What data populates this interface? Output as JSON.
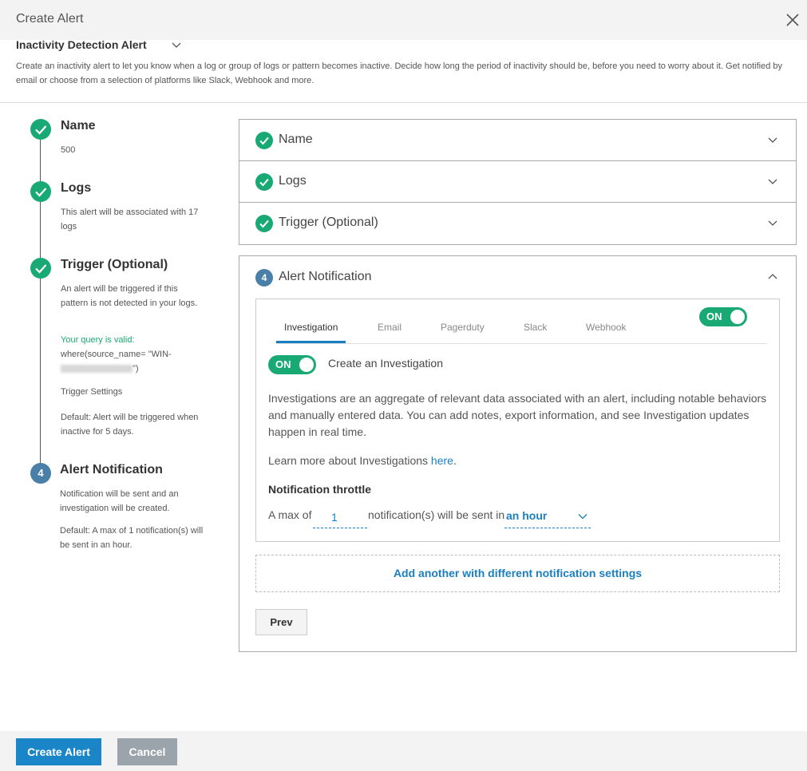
{
  "header": {
    "title": "Create Alert",
    "alert_type": "Inactivity Detection Alert",
    "description": "Create an inactivity alert to let you know when a log or group of logs or pattern becomes inactive. Decide how long the period of inactivity should be, before you need to worry about it. Get notified by email or choose from a selection of platforms like Slack, Webhook and more."
  },
  "stepper": {
    "step1": {
      "title": "Name",
      "text": "500"
    },
    "step2": {
      "title": "Logs",
      "text": "This alert will be associated with 17 logs"
    },
    "step3": {
      "title": "Trigger (Optional)",
      "text": "An alert will be triggered if this pattern is not detected in your logs.",
      "query_prefix": "Your query is valid:",
      "query": " where(source_name= \"WIN-",
      "query_end": "\")",
      "settings_label": "Trigger Settings",
      "settings_text": "Default: Alert will be triggered when inactive for 5 days."
    },
    "step4": {
      "number": "4",
      "title": "Alert Notification",
      "text": "Notification will be sent and an investigation will be created.",
      "default_text": "Default: A max of 1 notification(s) will be sent in an hour."
    }
  },
  "accordion": {
    "name": "Name",
    "logs": "Logs",
    "trigger": "Trigger (Optional)"
  },
  "notification": {
    "number": "4",
    "title": "Alert Notification",
    "tabs": [
      "Investigation",
      "Email",
      "Pagerduty",
      "Slack",
      "Webhook"
    ],
    "master_toggle": "ON",
    "investigation_toggle": "ON",
    "create_investigation": "Create an Investigation",
    "para1": "Investigations are an aggregate of relevant data associated with an alert, including notable behaviors and manually entered data. You can add notes, export information, and see Investigation updates happen in real time.",
    "learn_more": "Learn more about Investigations ",
    "here_link": "here",
    "period": ".",
    "throttle_title": "Notification throttle",
    "throttle_prefix": "A max of",
    "throttle_value": "1",
    "throttle_middle": "notification(s) will be sent in",
    "throttle_period": "an hour",
    "add_another": "Add another with different notification settings",
    "prev": "Prev"
  },
  "footer": {
    "create": "Create Alert",
    "cancel": "Cancel"
  },
  "colors": {
    "success": "#19a974",
    "step_number": "#4a7fa8",
    "link": "#1a7fc1",
    "primary_button": "#1a86c8",
    "secondary_button": "#9ba3ab"
  }
}
